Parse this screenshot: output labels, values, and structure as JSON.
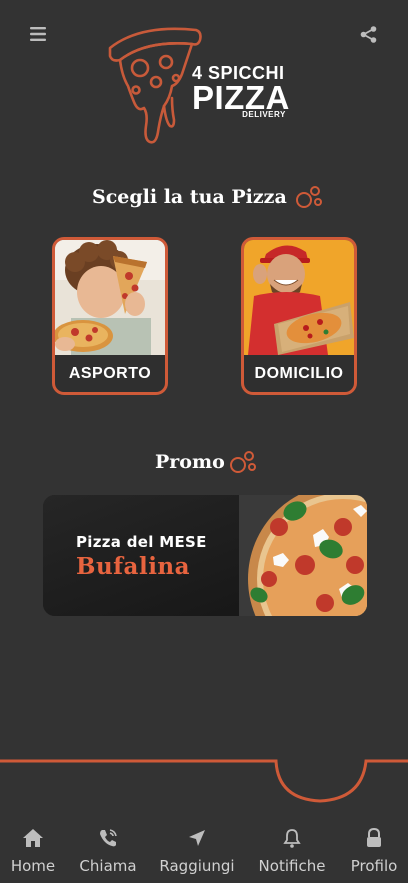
{
  "header": {
    "menu_icon": "hamburger-menu-icon",
    "share_icon": "share-icon"
  },
  "logo": {
    "line1": "4 SPICCHI",
    "line2": "PIZZA",
    "line3": "DELIVERY",
    "icon": "pizza-slice-icon"
  },
  "choose_section": {
    "title": "Scegli la tua Pizza",
    "cards": [
      {
        "label": "ASPORTO",
        "image": "child-eating-pizza-photo"
      },
      {
        "label": "DOMICILIO",
        "image": "delivery-man-with-pizza-photo"
      }
    ]
  },
  "promo_section": {
    "title": "Promo",
    "banner": {
      "subtitle": "Pizza del MESE",
      "name": "Bufalina",
      "image": "bufalina-pizza-photo"
    }
  },
  "bottom_nav": {
    "items": [
      {
        "label": "Home",
        "icon": "home-icon"
      },
      {
        "label": "Chiama",
        "icon": "phone-icon"
      },
      {
        "label": "Raggiungi",
        "icon": "navigation-arrow-icon"
      },
      {
        "label": "Notifiche",
        "icon": "bell-icon"
      },
      {
        "label": "Profilo",
        "icon": "lock-icon"
      }
    ]
  },
  "colors": {
    "background": "#333333",
    "accent": "#cf5a38",
    "promo_name": "#e8643f",
    "text": "#ffffff",
    "nav_icon": "#bdbdbd"
  }
}
